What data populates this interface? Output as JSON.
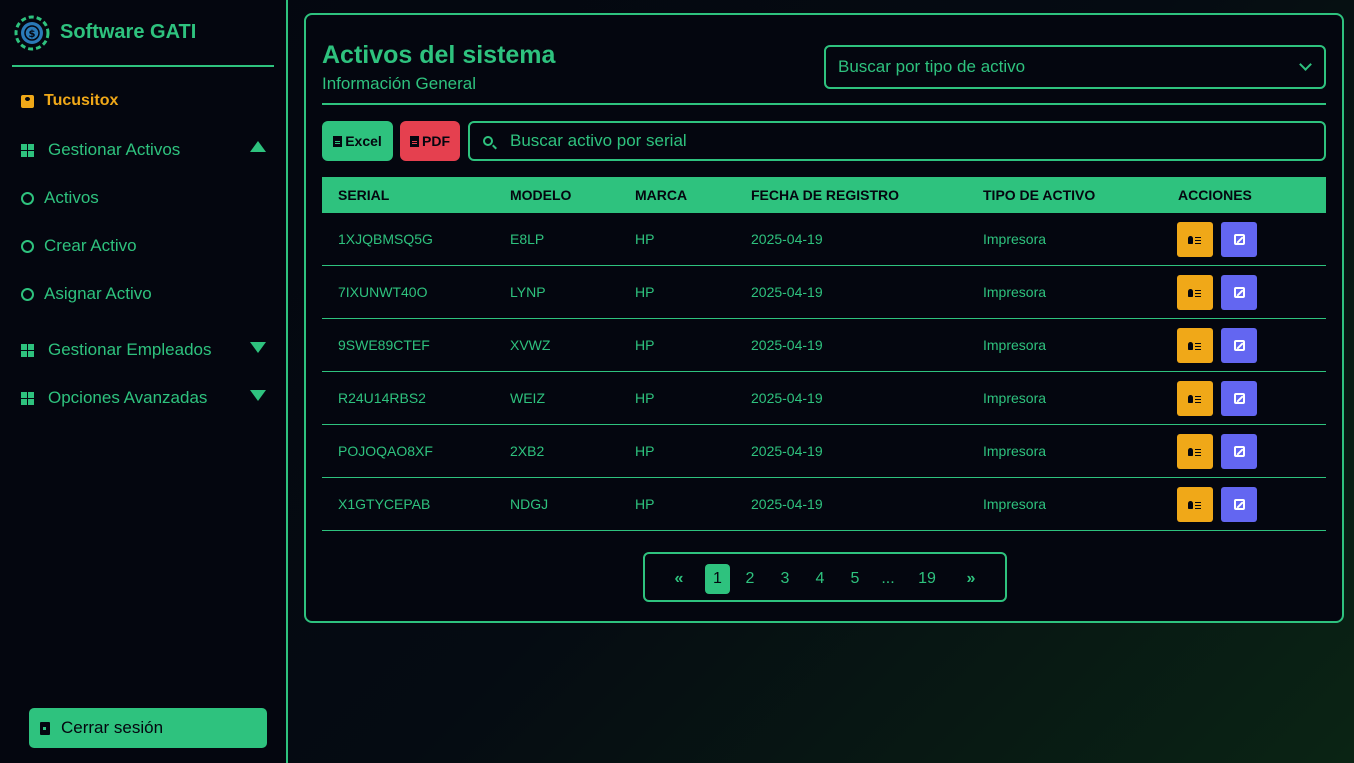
{
  "sidebar": {
    "app_title": "Software GATI",
    "user_name": "Tucusitox",
    "menu": [
      {
        "label": "Gestionar Activos",
        "expanded": true
      },
      {
        "label": "Gestionar Empleados",
        "expanded": false
      },
      {
        "label": "Opciones Avanzadas",
        "expanded": false
      }
    ],
    "submenu": [
      "Activos",
      "Crear Activo",
      "Asignar Activo"
    ],
    "logout_label": "Cerrar sesión"
  },
  "main": {
    "title": "Activos del sistema",
    "subtitle": "Información General",
    "type_filter_placeholder": "Buscar por tipo de activo",
    "excel_label": "Excel",
    "pdf_label": "PDF",
    "search_placeholder": "Buscar activo por serial",
    "table": {
      "headers": [
        "SERIAL",
        "MODELO",
        "MARCA",
        "FECHA DE REGISTRO",
        "TIPO DE ACTIVO",
        "ACCIONES"
      ],
      "rows": [
        [
          "1XJQBMSQ5G",
          "E8LP",
          "HP",
          "2025-04-19",
          "Impresora"
        ],
        [
          "7IXUNWT40O",
          "LYNP",
          "HP",
          "2025-04-19",
          "Impresora"
        ],
        [
          "9SWE89CTEF",
          "XVWZ",
          "HP",
          "2025-04-19",
          "Impresora"
        ],
        [
          "R24U14RBS2",
          "WEIZ",
          "HP",
          "2025-04-19",
          "Impresora"
        ],
        [
          "POJOQAO8XF",
          "2XB2",
          "HP",
          "2025-04-19",
          "Impresora"
        ],
        [
          "X1GTYCEPAB",
          "NDGJ",
          "HP",
          "2025-04-19",
          "Impresora"
        ]
      ]
    },
    "pagination": {
      "prev": "«",
      "pages": [
        "1",
        "2",
        "3",
        "4",
        "5",
        "...",
        "19"
      ],
      "next": "»",
      "current": "1"
    }
  },
  "colors": {
    "accent": "#2ec27e",
    "background": "#04060f",
    "pdf": "#e5404f",
    "assign": "#f0a818",
    "edit": "#6366f1"
  }
}
